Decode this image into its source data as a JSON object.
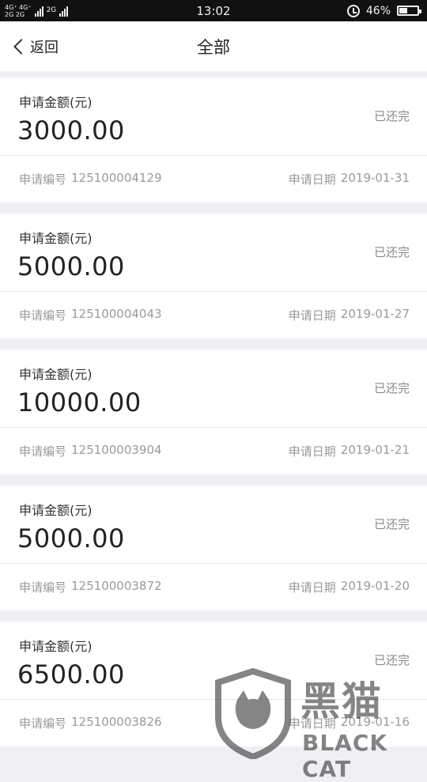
{
  "status_bar": {
    "network_top": "4G⁺ 4G⁺",
    "network_bottom": "2G 2G",
    "network_extra": "2G",
    "time": "13:02",
    "battery": "46%",
    "battery_level": 0.46
  },
  "nav": {
    "back_label": "返回",
    "title": "全部"
  },
  "labels": {
    "amount": "申请金额(元)",
    "number": "申请编号",
    "date": "申请日期"
  },
  "records": [
    {
      "amount": "3000.00",
      "status": "已还完",
      "number": "125100004129",
      "date": "2019-01-31"
    },
    {
      "amount": "5000.00",
      "status": "已还完",
      "number": "125100004043",
      "date": "2019-01-27"
    },
    {
      "amount": "10000.00",
      "status": "已还完",
      "number": "125100003904",
      "date": "2019-01-21"
    },
    {
      "amount": "5000.00",
      "status": "已还完",
      "number": "125100003872",
      "date": "2019-01-20"
    },
    {
      "amount": "6500.00",
      "status": "已还完",
      "number": "125100003826",
      "date": "2019-01-16"
    }
  ],
  "watermark": {
    "cn": "黑猫",
    "en": "BLACK CAT"
  }
}
